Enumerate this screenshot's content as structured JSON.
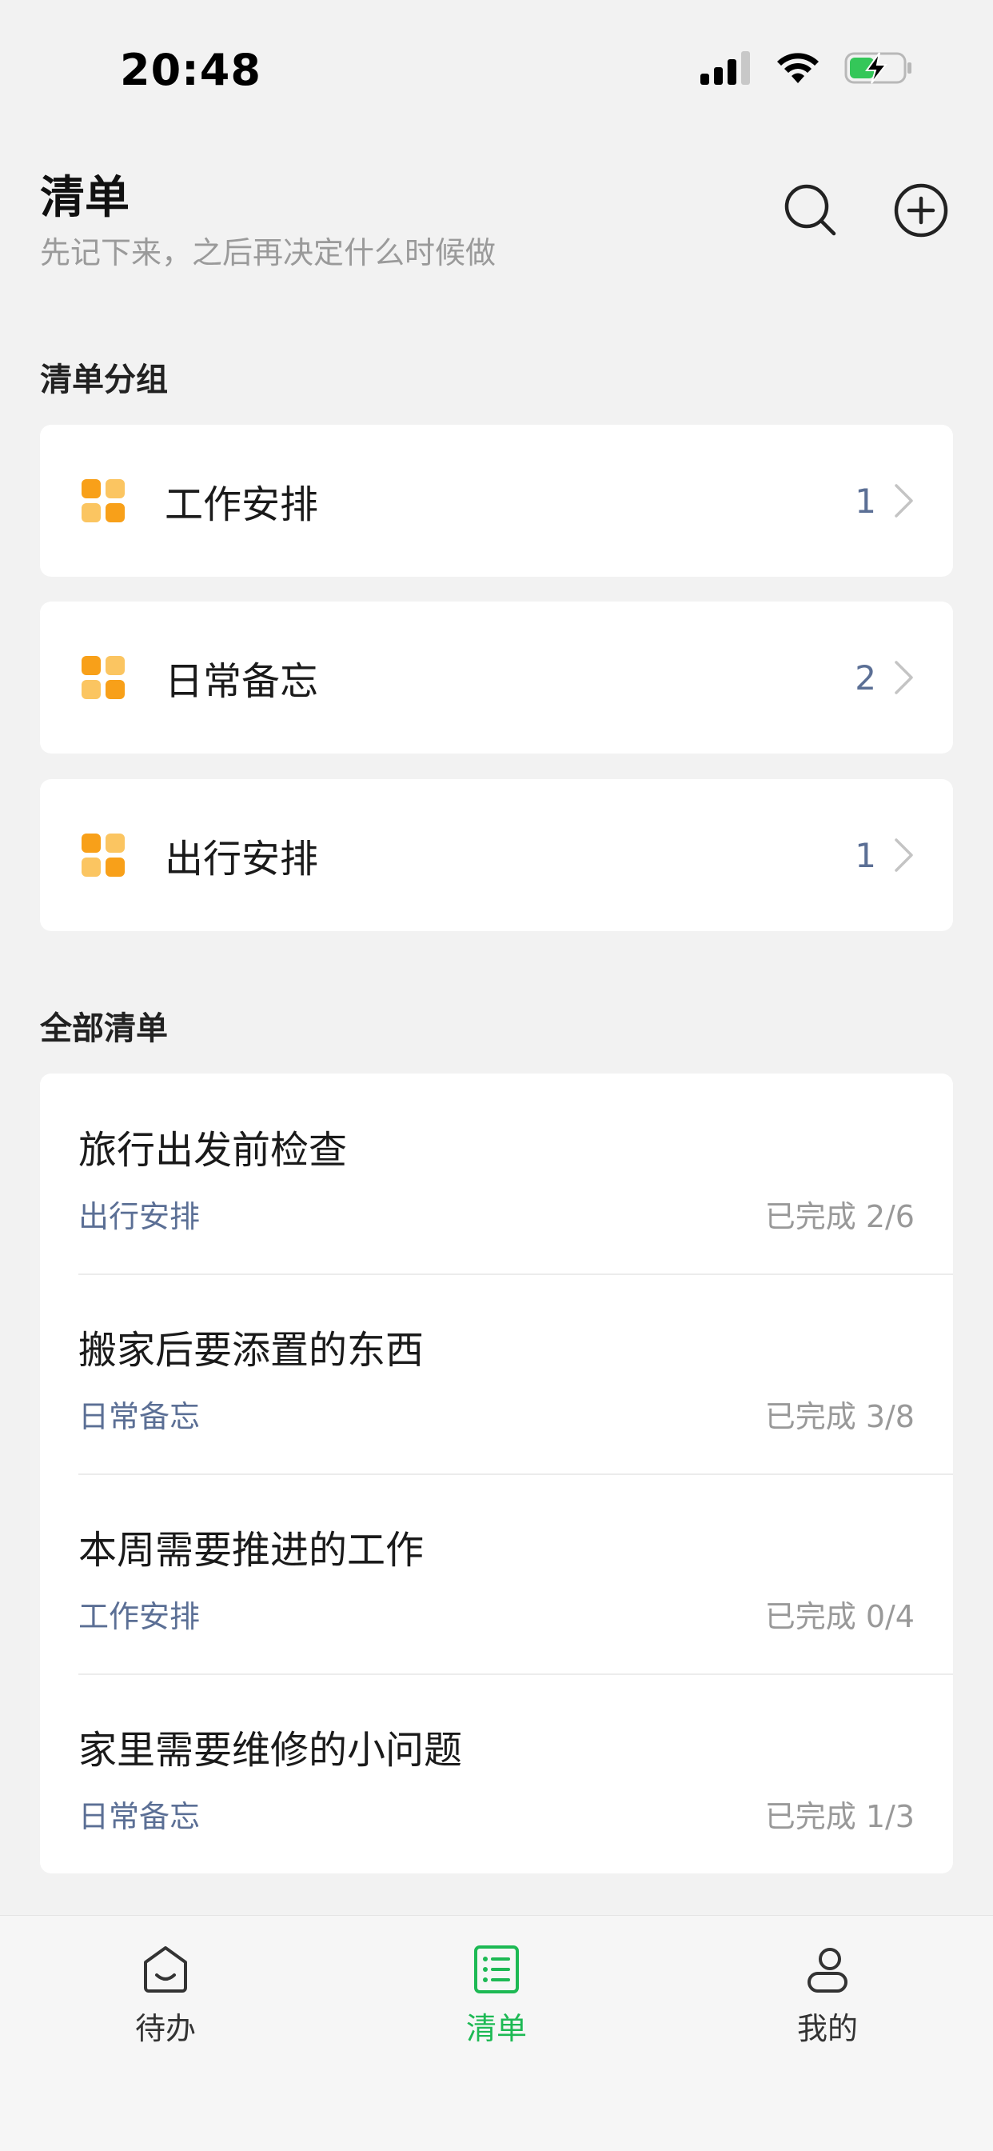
{
  "status_bar": {
    "time": "20:48"
  },
  "header": {
    "title": "清单",
    "subtitle": "先记下来，之后再决定什么时候做",
    "search_icon": "search-icon",
    "add_icon": "plus-circle-icon"
  },
  "groups_section": {
    "label": "清单分组",
    "items": [
      {
        "name": "工作安排",
        "count": "1"
      },
      {
        "name": "日常备忘",
        "count": "2"
      },
      {
        "name": "出行安排",
        "count": "1"
      }
    ]
  },
  "all_lists_section": {
    "label": "全部清单",
    "items": [
      {
        "title": "旅行出发前检查",
        "group": "出行安排",
        "progress": "已完成 2/6"
      },
      {
        "title": "搬家后要添置的东西",
        "group": "日常备忘",
        "progress": "已完成 3/8"
      },
      {
        "title": "本周需要推进的工作",
        "group": "工作安排",
        "progress": "已完成 0/4"
      },
      {
        "title": "家里需要维修的小问题",
        "group": "日常备忘",
        "progress": "已完成 1/3"
      }
    ]
  },
  "tab_bar": {
    "tabs": [
      {
        "label": "待办",
        "icon": "inbox-icon"
      },
      {
        "label": "清单",
        "icon": "list-icon"
      },
      {
        "label": "我的",
        "icon": "person-icon"
      }
    ],
    "active_color": "#1db954"
  },
  "colors": {
    "accent": "#1db954",
    "group_icon_dark": "#f8a019",
    "group_icon_light": "#fbc561",
    "link_text": "#5b6f95"
  }
}
